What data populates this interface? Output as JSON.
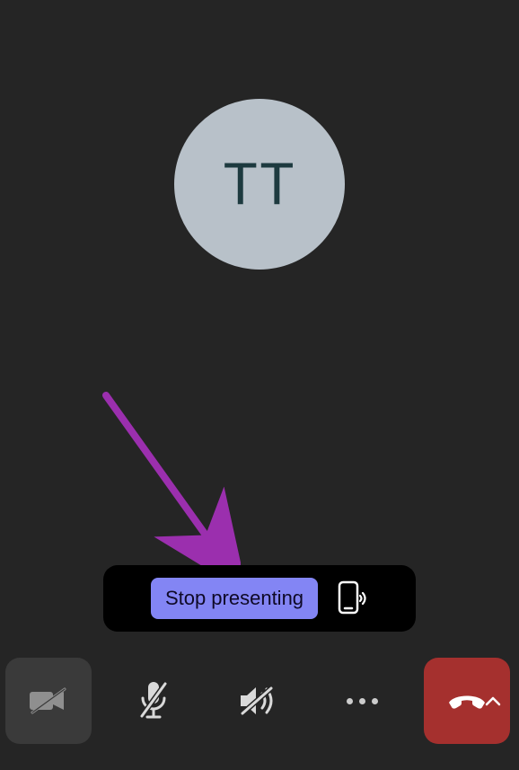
{
  "avatar": {
    "initials": "TT"
  },
  "present_bar": {
    "stop_label": "Stop presenting"
  },
  "colors": {
    "accent_button": "#8385f4",
    "end_call": "#a5302e",
    "arrow": "#9b2fae"
  },
  "icons": {
    "camera_off": "camera-off-icon",
    "mic_off": "mic-off-icon",
    "speaker_off": "speaker-off-icon",
    "more": "more-icon",
    "phone_hangup": "phone-hangup-icon",
    "chevron_up": "chevron-up-icon",
    "device_audio": "phone-speaker-icon"
  }
}
